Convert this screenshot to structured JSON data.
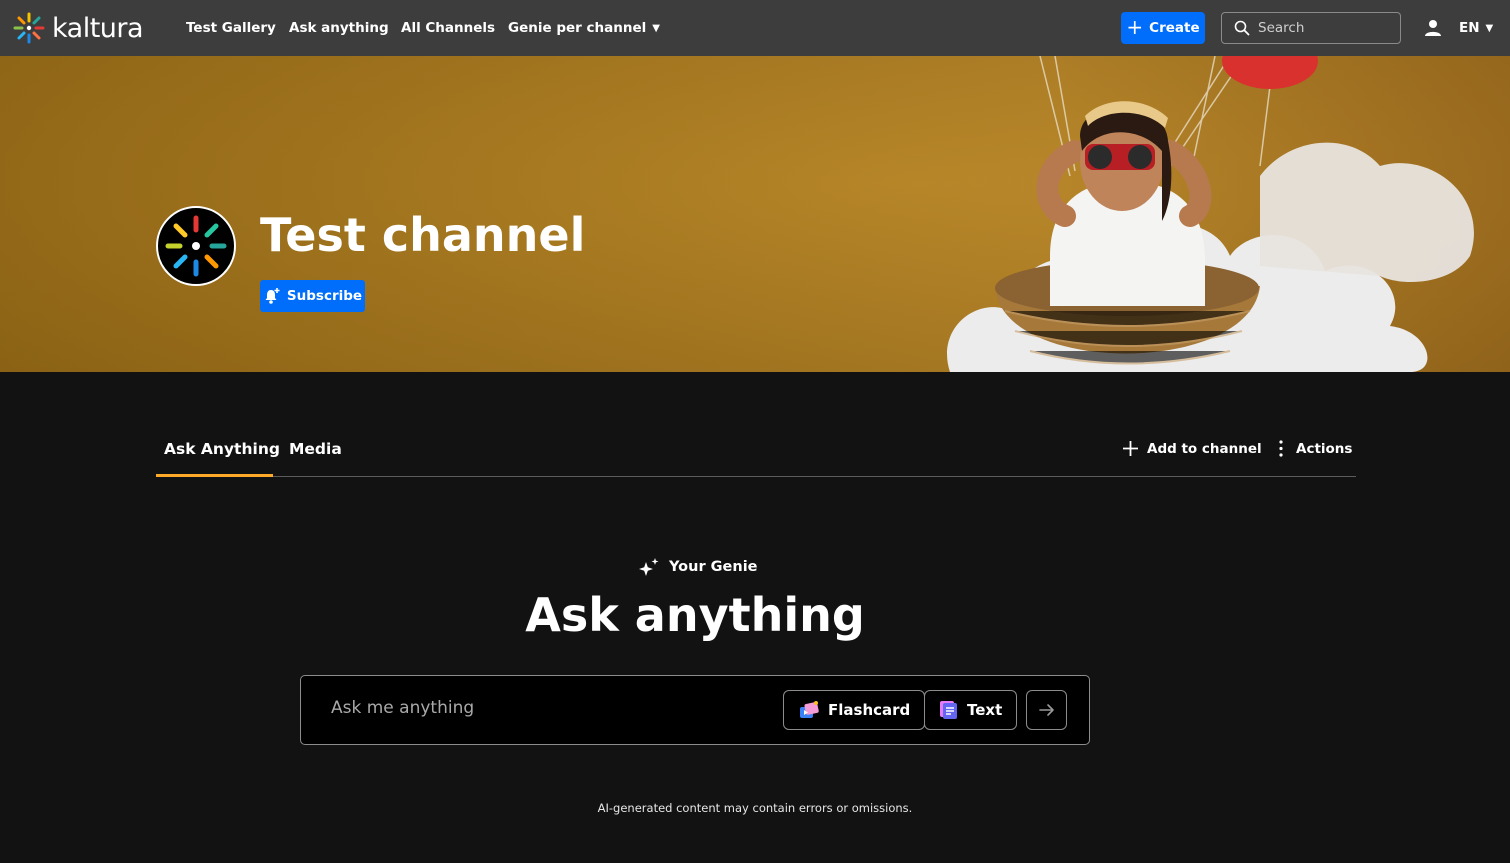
{
  "header": {
    "logo_text": "kaltura",
    "nav": [
      {
        "label": "Test Gallery"
      },
      {
        "label": "Ask anything"
      },
      {
        "label": "All Channels"
      },
      {
        "label": "Genie per channel"
      }
    ],
    "create_label": "Create",
    "search_placeholder": "Search",
    "language": "EN"
  },
  "hero": {
    "channel_title": "Test channel",
    "subscribe_label": "Subscribe"
  },
  "tabs": {
    "items": [
      {
        "label": "Ask Anything",
        "active": true
      },
      {
        "label": "Media",
        "active": false
      }
    ],
    "add_to_channel_label": "Add to channel",
    "actions_label": "Actions"
  },
  "genie": {
    "eyebrow": "Your Genie",
    "title": "Ask anything",
    "input_placeholder": "Ask me anything",
    "flashcard_label": "Flashcard",
    "text_label": "Text",
    "disclaimer": "AI-generated content may contain errors or omissions."
  },
  "colors": {
    "topbar": "#3d3d3d",
    "accent_blue": "#006efa",
    "tab_underline": "#ffa928",
    "page_bg": "#121212"
  },
  "icons": [
    "kaltura-logo-icon",
    "chevron-down-icon",
    "plus-icon",
    "search-icon",
    "user-icon",
    "bell-plus-icon",
    "more-vertical-icon",
    "sparkle-icon",
    "flashcard-icon",
    "text-doc-icon",
    "arrow-right-icon"
  ]
}
